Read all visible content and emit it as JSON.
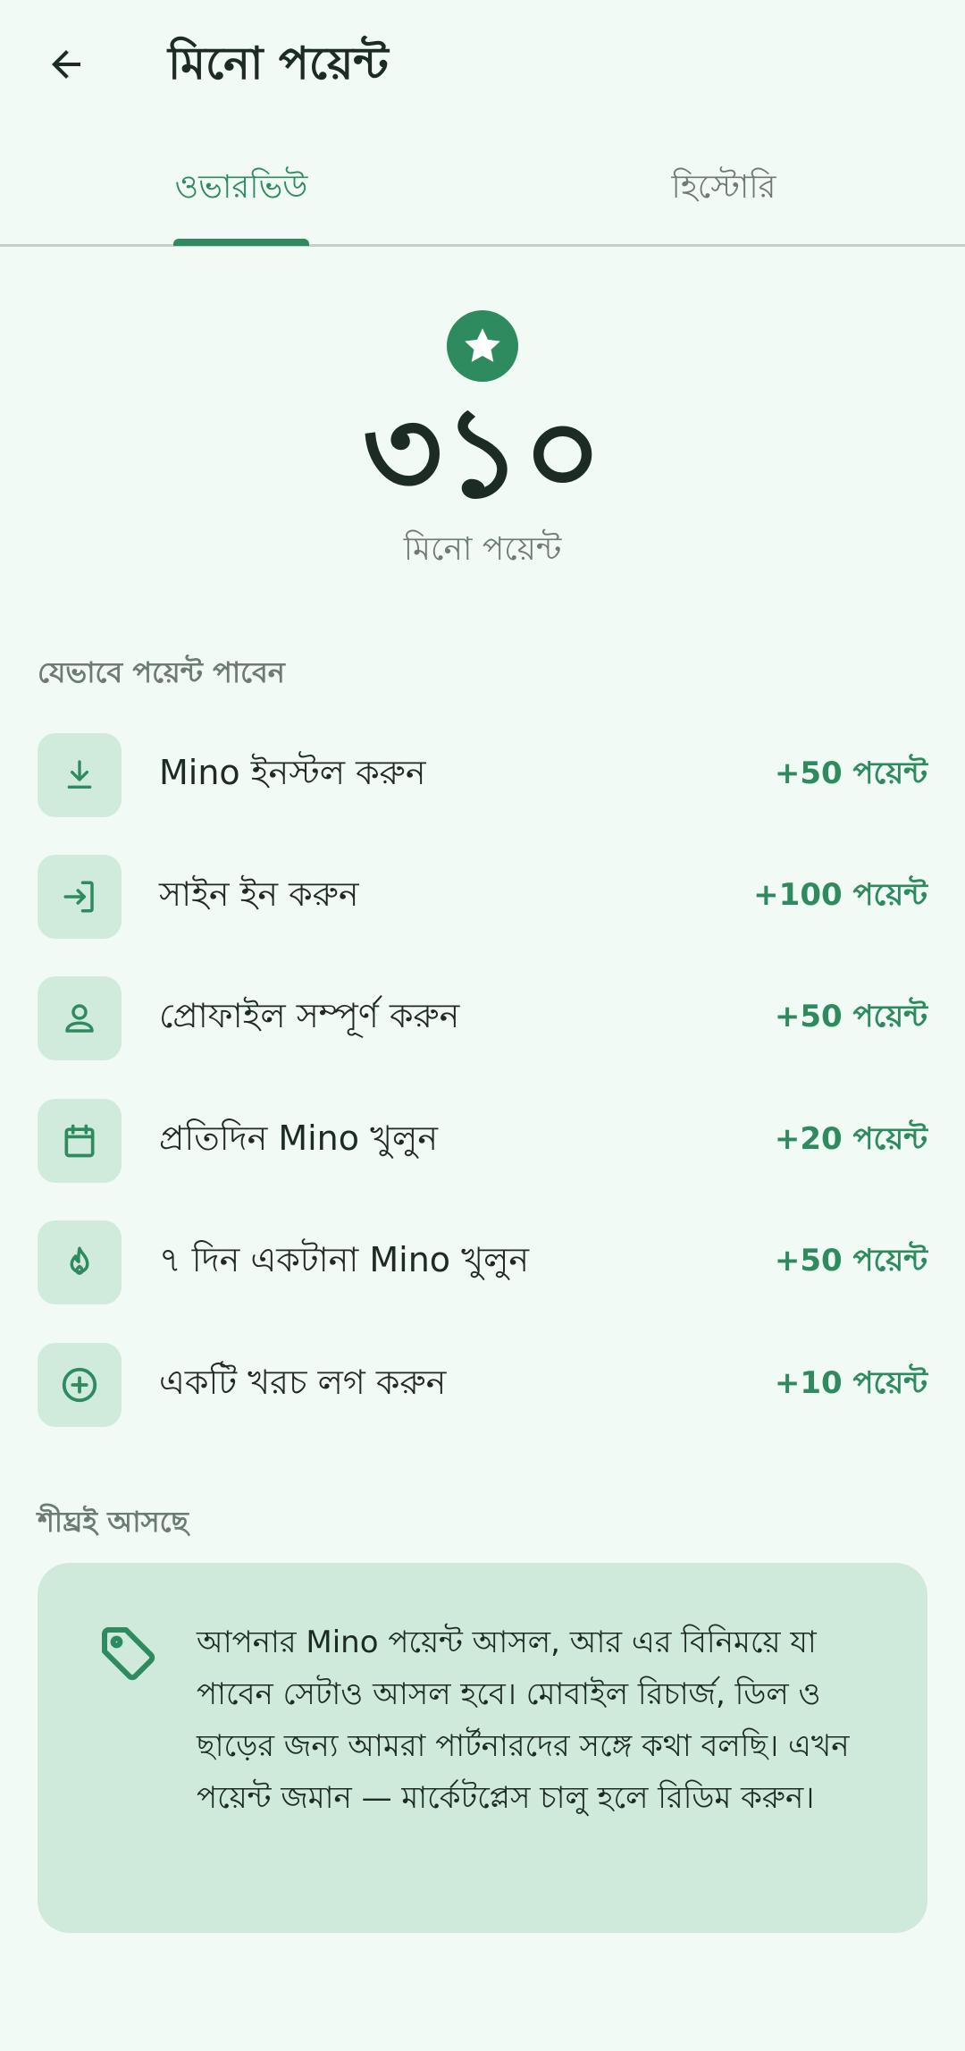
{
  "header": {
    "title": "মিনো পয়েন্ট",
    "back_icon": "arrow-back-icon"
  },
  "tabs": [
    {
      "label": "ওভারভিউ",
      "selected": true
    },
    {
      "label": "হিস্টোরি",
      "selected": false
    }
  ],
  "summary": {
    "points": "৩১০",
    "label": "মিনো পয়েন্ট",
    "icon": "star-icon"
  },
  "earn": {
    "heading": "যেভাবে পয়েন্ট পাবেন",
    "items": [
      {
        "icon": "download-icon",
        "label": "Mino ইনস্টল করুন",
        "points": "+50 পয়েন্ট"
      },
      {
        "icon": "login-icon",
        "label": "সাইন ইন করুন",
        "points": "+100 পয়েন্ট"
      },
      {
        "icon": "person-icon",
        "label": "প্রোফাইল সম্পূর্ণ করুন",
        "points": "+50 পয়েন্ট"
      },
      {
        "icon": "calendar-icon",
        "label": "প্রতিদিন Mino খুলুন",
        "points": "+20 পয়েন্ট"
      },
      {
        "icon": "flame-icon",
        "label": "৭ দিন একটানা Mino খুলুন",
        "points": "+50 পয়েন্ট"
      },
      {
        "icon": "add-circle-icon",
        "label": "একটি খরচ লগ করুন",
        "points": "+10 পয়েন্ট"
      }
    ]
  },
  "coming_soon": {
    "heading": "শীঘ্রই আসছে",
    "icon": "tag-icon",
    "text": "আপনার Mino পয়েন্ট আসল, আর এর বিনিময়ে যা পাবেন সেটাও আসল হবে। মোবাইল রিচার্জ, ডিল ও ছাড়ের জন্য আমরা পার্টনারদের সঙ্গে কথা বলছি। এখন পয়েন্ট জমান — মার্কেটপ্লেস চালু হলে রিডিম করুন।"
  },
  "colors": {
    "background": "#f1faf4",
    "accent": "#2e8b5f",
    "icon_tile": "#d0ebdb",
    "card": "#cfe9da",
    "text": "#1c2b24",
    "muted": "#6c7b74"
  }
}
